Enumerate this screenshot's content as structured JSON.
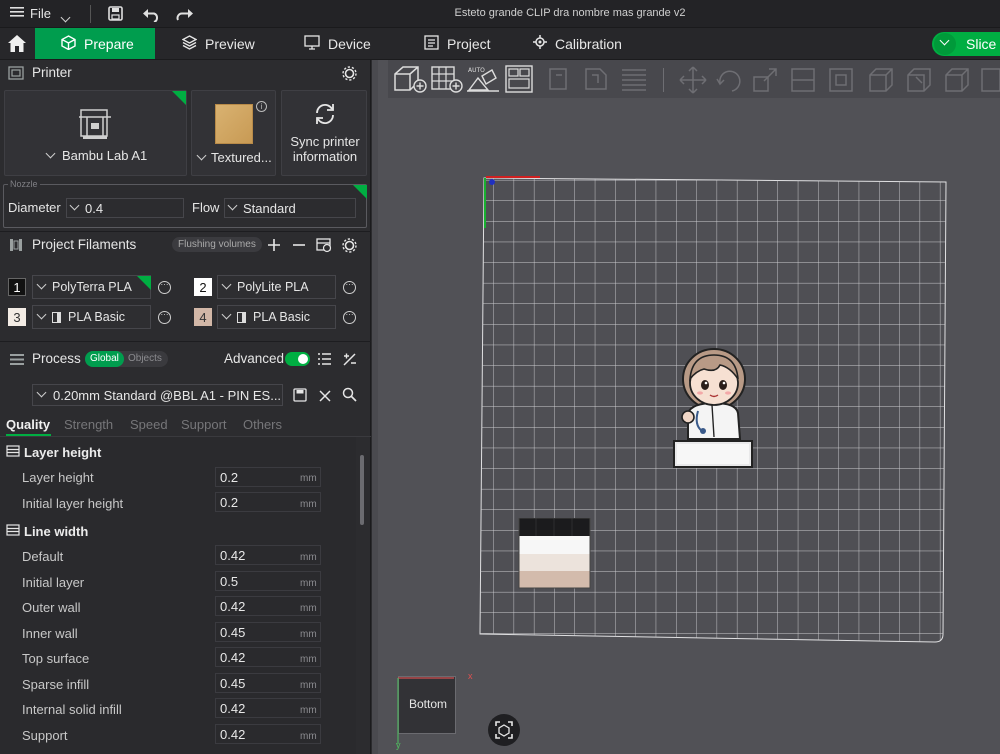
{
  "titlebar": {
    "file_label": "File",
    "window_title": "Esteto grande CLIP dra nombre mas grande v2"
  },
  "tabs": [
    {
      "label": "Prepare",
      "icon": "cube-icon",
      "active": true
    },
    {
      "label": "Preview",
      "icon": "layers-icon",
      "active": false
    },
    {
      "label": "Device",
      "icon": "device-icon",
      "active": false
    },
    {
      "label": "Project",
      "icon": "project-icon",
      "active": false
    },
    {
      "label": "Calibration",
      "icon": "calibration-icon",
      "active": false
    }
  ],
  "slice_label": "Slice p",
  "printer": {
    "section_title": "Printer",
    "printer_name": "Bambu Lab A1",
    "plate_name": "Textured...",
    "sync_label_1": "Sync printer",
    "sync_label_2": "information",
    "nozzle_legend": "Nozzle",
    "diameter_label": "Diameter",
    "diameter_value": "0.4",
    "flow_label": "Flow",
    "flow_value": "Standard"
  },
  "filaments": {
    "section_title": "Project Filaments",
    "flushing_label": "Flushing volumes",
    "items": [
      {
        "num": "1",
        "name": "PolyTerra PLA",
        "swatch": "#111111",
        "num_color": "#ffffff"
      },
      {
        "num": "2",
        "name": "PolyLite PLA",
        "swatch": "#ffffff",
        "num_color": "#111111"
      },
      {
        "num": "3",
        "name": "PLA Basic",
        "swatch": "#f3ece5",
        "num_color": "#333333"
      },
      {
        "num": "4",
        "name": "PLA Basic",
        "swatch": "#d2b7a7",
        "num_color": "#333333"
      }
    ]
  },
  "process": {
    "section_title": "Process",
    "global_label": "Global",
    "objects_label": "Objects",
    "advanced_label": "Advanced",
    "preset": "0.20mm Standard @BBL A1 - PIN ES...",
    "subtabs": [
      "Quality",
      "Strength",
      "Speed",
      "Support",
      "Others"
    ],
    "groups": {
      "layer_height": {
        "title": "Layer height",
        "rows": [
          {
            "label": "Layer height",
            "value": "0.2",
            "unit": "mm"
          },
          {
            "label": "Initial layer height",
            "value": "0.2",
            "unit": "mm"
          }
        ]
      },
      "line_width": {
        "title": "Line width",
        "rows": [
          {
            "label": "Default",
            "value": "0.42",
            "unit": "mm"
          },
          {
            "label": "Initial layer",
            "value": "0.5",
            "unit": "mm"
          },
          {
            "label": "Outer wall",
            "value": "0.42",
            "unit": "mm"
          },
          {
            "label": "Inner wall",
            "value": "0.45",
            "unit": "mm"
          },
          {
            "label": "Top surface",
            "value": "0.42",
            "unit": "mm"
          },
          {
            "label": "Sparse infill",
            "value": "0.45",
            "unit": "mm"
          },
          {
            "label": "Internal solid infill",
            "value": "0.42",
            "unit": "mm"
          },
          {
            "label": "Support",
            "value": "0.42",
            "unit": "mm"
          }
        ]
      }
    }
  },
  "viewport": {
    "view_cube_label": "Bottom",
    "axis_x": "x",
    "axis_y": "y"
  },
  "colors": {
    "accent": "#00ae42",
    "panel": "#2c2c2f",
    "viewport": "#515156"
  }
}
